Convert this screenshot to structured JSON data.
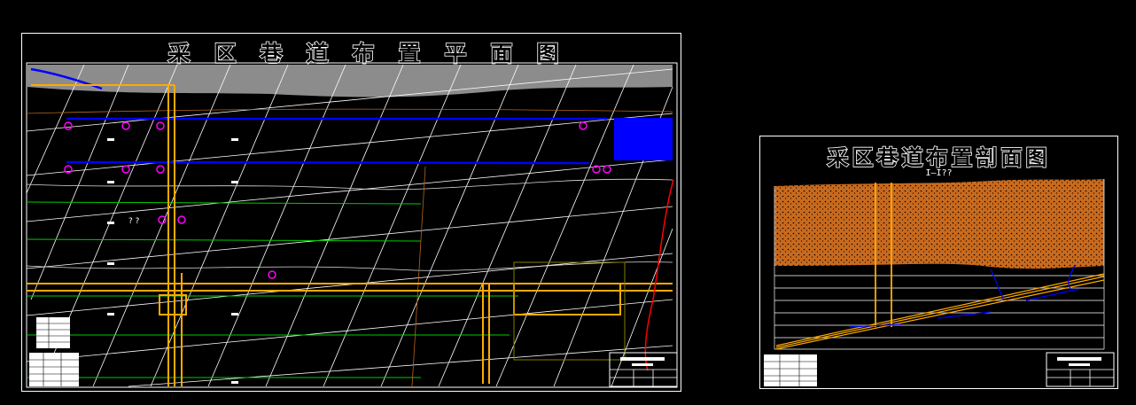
{
  "plan_sheet": {
    "title": "采区巷道布置平面图",
    "labels": [
      "? ?"
    ]
  },
  "section_sheet": {
    "title": "采区巷道布置剖面图",
    "subtitle": "I—I??"
  },
  "colors": {
    "background": "#000000",
    "frame": "#ffffff",
    "surface_band": "#8c8c8c",
    "roadway_blue": "#0000ff",
    "shaft_orange": "#ffaa00",
    "marker_magenta": "#ff00ff",
    "contour_green": "#00cc00",
    "fault_red": "#ff0000",
    "rock_fill": "#c86a1e"
  }
}
